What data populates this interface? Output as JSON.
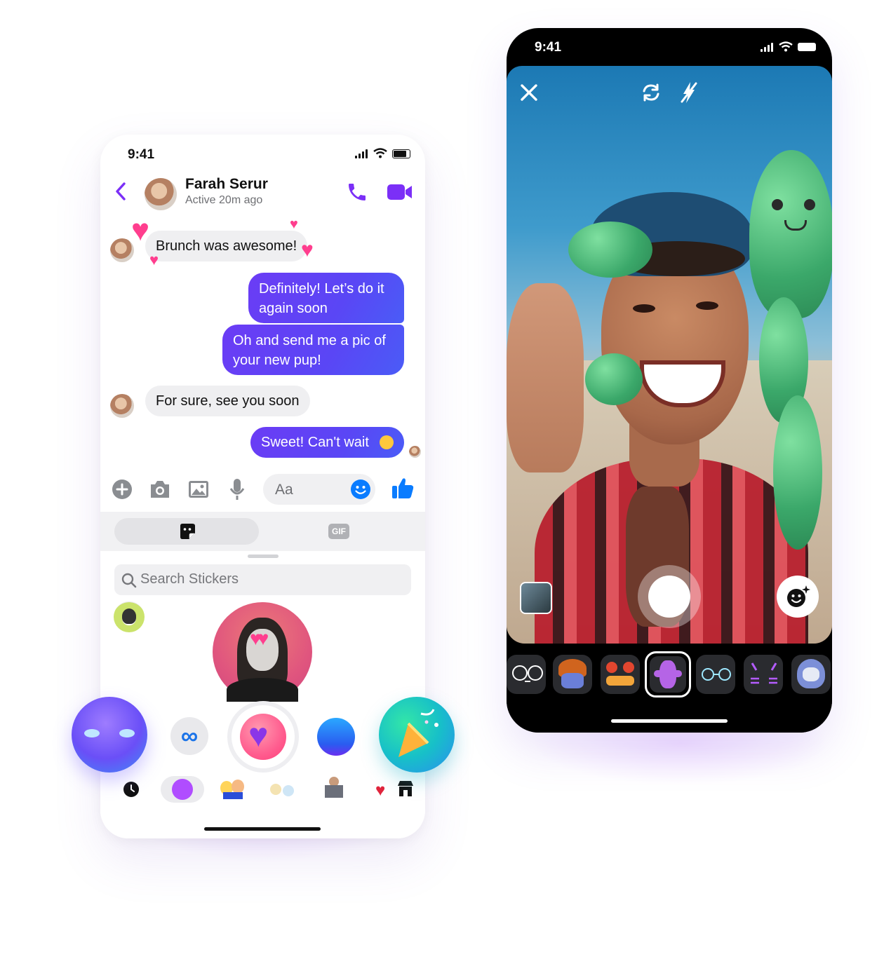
{
  "left_phone": {
    "status_time": "9:41",
    "header": {
      "contact_name": "Farah Serur",
      "active_status": "Active 20m ago"
    },
    "messages": [
      {
        "from": "them",
        "text": "Brunch was awesome!"
      },
      {
        "from": "me",
        "text": "Definitely! Let’s do it again soon"
      },
      {
        "from": "me",
        "text": "Oh and send me a pic of your new pup!"
      },
      {
        "from": "them",
        "text": "For sure, see you soon"
      },
      {
        "from": "me",
        "text": "Sweet! Can't wait"
      }
    ],
    "composer": {
      "placeholder": "Aa"
    },
    "tray_tabs": {
      "gif_label": "GIF"
    },
    "sticker_search": {
      "placeholder": "Search Stickers"
    },
    "sticker_categories": [
      "recent",
      "love",
      "friends",
      "bunnies",
      "reading",
      "hearts",
      "store"
    ],
    "accent_color": "#7b2ff7"
  },
  "right_phone": {
    "status_time": "9:41",
    "camera_controls": [
      "close-icon",
      "flip-camera-icon",
      "flash-off-icon"
    ],
    "face_effects": [
      "cat-outline-mask",
      "hair-mask",
      "cheese-bear-mask",
      "cactus-balloon",
      "sparkle-glasses",
      "cat-whiskers",
      "robot-helmet"
    ],
    "selected_effect": "cactus-balloon"
  }
}
